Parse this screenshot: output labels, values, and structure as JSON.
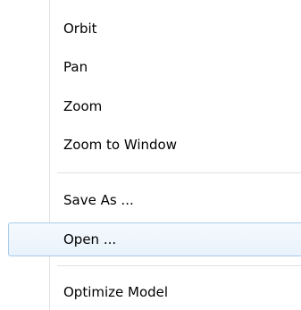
{
  "menu": {
    "items": [
      {
        "label": "Orbit"
      },
      {
        "label": "Pan"
      },
      {
        "label": "Zoom"
      },
      {
        "label": "Zoom to Window"
      },
      {
        "label": "Save As ..."
      },
      {
        "label": "Open ..."
      },
      {
        "label": "Optimize Model"
      }
    ],
    "highlighted_item": "Open ...",
    "colors": {
      "highlight_border": "#a8cbea",
      "highlight_fill": "#e9f2fb",
      "separator": "#e0e0e0"
    }
  }
}
